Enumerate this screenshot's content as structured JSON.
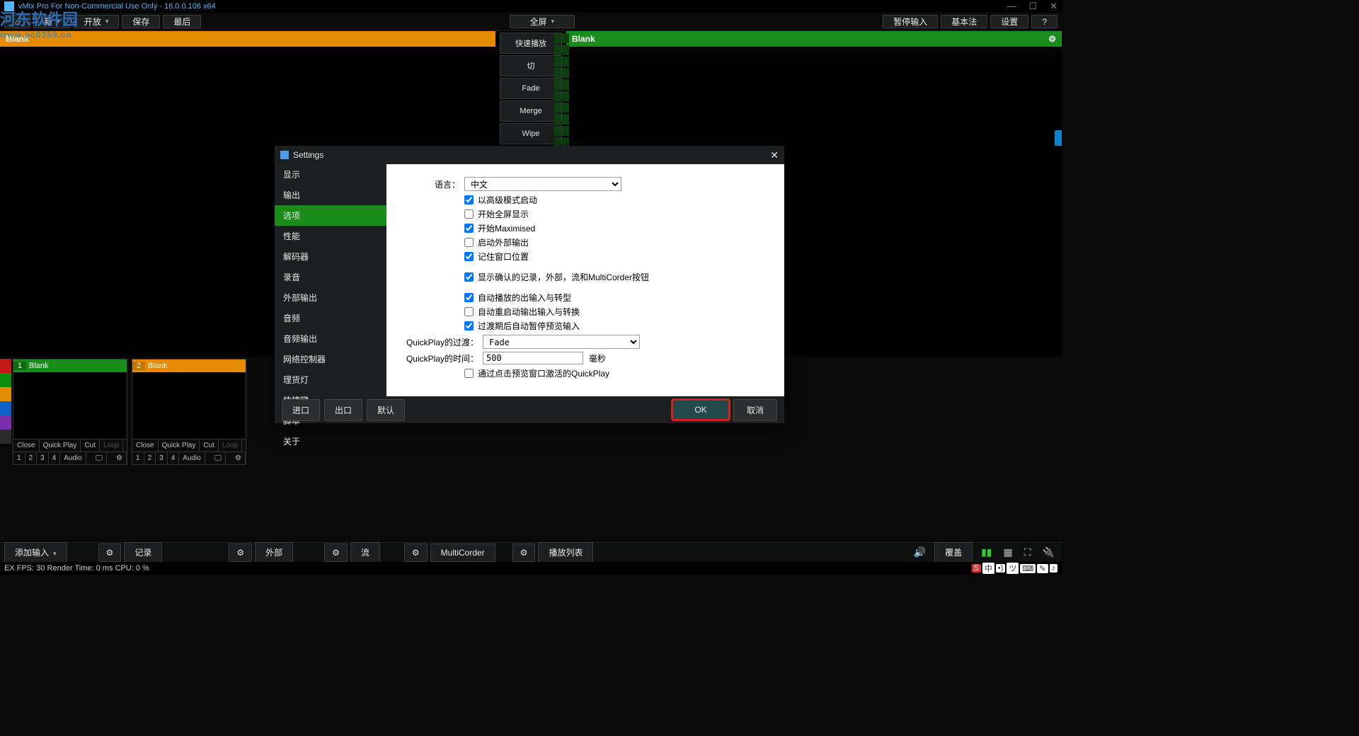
{
  "title": "vMix Pro For Non-Commercial Use Only - 16.0.0.106 x64",
  "watermark": {
    "line1": "河东软件园",
    "line2": "www.pc0359.cn"
  },
  "toolbar": {
    "new": "新",
    "open": "开放",
    "save": "保存",
    "last": "最后",
    "fullscreen": "全屏",
    "pauseInput": "暂停输入",
    "basic": "基本法",
    "settings": "设置",
    "help": "?"
  },
  "preview": {
    "left": "Blank",
    "right": "Blank"
  },
  "center": {
    "quickplay": "快速播放",
    "cut": "切",
    "fade": "Fade",
    "merge": "Merge",
    "wipe": "Wipe"
  },
  "tiles": [
    {
      "num": "1",
      "name": "Blank"
    },
    {
      "num": "2",
      "name": "Blank"
    }
  ],
  "tileActions": {
    "close": "Close",
    "qp": "Quick Play",
    "cut": "Cut",
    "loop": "Loop",
    "audio": "Audio",
    "b1": "1",
    "b2": "2",
    "b3": "3",
    "b4": "4"
  },
  "bottom": {
    "addInput": "添加输入",
    "record": "记录",
    "external": "外部",
    "stream": "流",
    "multi": "MultiCorder",
    "playlist": "播放列表",
    "overlay": "覆盖"
  },
  "status": "EX  FPS:  30   Render Time:  0 ms   CPU:  0 %",
  "ime": {
    "s": "S",
    "c": "中",
    "d": "•)",
    "q": "ツ",
    "k": "⌨",
    "h": "✎",
    "sp": "♪"
  },
  "dlg": {
    "title": "Settings",
    "side": [
      "显示",
      "输出",
      "选项",
      "性能",
      "解码器",
      "录音",
      "外部输出",
      "音频",
      "音频输出",
      "网络控制器",
      "理货灯",
      "快捷键",
      "脚本",
      "关于"
    ],
    "langLabel": "语言：",
    "langValue": "中文",
    "cb": {
      "adv": "以高级模式启动",
      "fs": "开始全屏显示",
      "max": "开始Maximised",
      "ext": "启动外部输出",
      "pos": "记住窗口位置",
      "conf": "显示确认的记录，外部，流和MultiCorder按钮",
      "auto1": "自动播放的出输入与转型",
      "auto2": "自动重启动输出输入与转换",
      "pause": "过渡期后自动暂停预览输入",
      "click": "通过点击预览窗口激活的QuickPlay"
    },
    "qpTransLabel": "QuickPlay的过渡：",
    "qpTransValue": "Fade",
    "qpTimeLabel": "QuickPlay的时间：",
    "qpTimeValue": "500",
    "ms": "毫秒",
    "import": "进口",
    "export": "出口",
    "default": "默认",
    "ok": "OK",
    "cancel": "取消"
  }
}
